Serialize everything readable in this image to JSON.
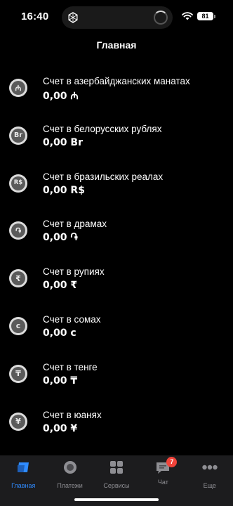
{
  "status": {
    "time": "16:40",
    "battery": "81"
  },
  "header": {
    "title": "Главная"
  },
  "accounts": [
    {
      "name": "Счет в азербайджанских манатах",
      "amount": "0,00 ₼",
      "symbol": "₼",
      "icon": "manat-icon"
    },
    {
      "name": "Счет в белорусских рублях",
      "amount": "0,00 Br",
      "symbol": "Br",
      "icon": "belarusian-ruble-icon"
    },
    {
      "name": "Счет в бразильских реалах",
      "amount": "0,00 R$",
      "symbol": "R$",
      "icon": "brazilian-real-icon"
    },
    {
      "name": "Счет в драмах",
      "amount": "0,00 ֏",
      "symbol": "֏",
      "icon": "dram-icon"
    },
    {
      "name": "Счет в рупиях",
      "amount": "0,00 ₹",
      "symbol": "₹",
      "icon": "rupee-icon"
    },
    {
      "name": "Счет в сомах",
      "amount": "0,00 с",
      "symbol": "с",
      "icon": "som-icon"
    },
    {
      "name": "Счет в тенге",
      "amount": "0,00 ₸",
      "symbol": "₸",
      "icon": "tenge-icon"
    },
    {
      "name": "Счет в юанях",
      "amount": "0,00 ¥",
      "symbol": "¥",
      "icon": "yuan-icon"
    }
  ],
  "tabs": [
    {
      "label": "Главная",
      "icon": "home-card-icon",
      "active": true
    },
    {
      "label": "Платежи",
      "icon": "payments-icon",
      "active": false
    },
    {
      "label": "Сервисы",
      "icon": "services-grid-icon",
      "active": false
    },
    {
      "label": "Чат",
      "icon": "chat-icon",
      "active": false,
      "badge": "7"
    },
    {
      "label": "Еще",
      "icon": "more-dots-icon",
      "active": false
    }
  ],
  "colors": {
    "accent": "#2f8bff",
    "badge": "#f0433a",
    "tabbar": "#1c1c1e",
    "background": "#000000"
  }
}
